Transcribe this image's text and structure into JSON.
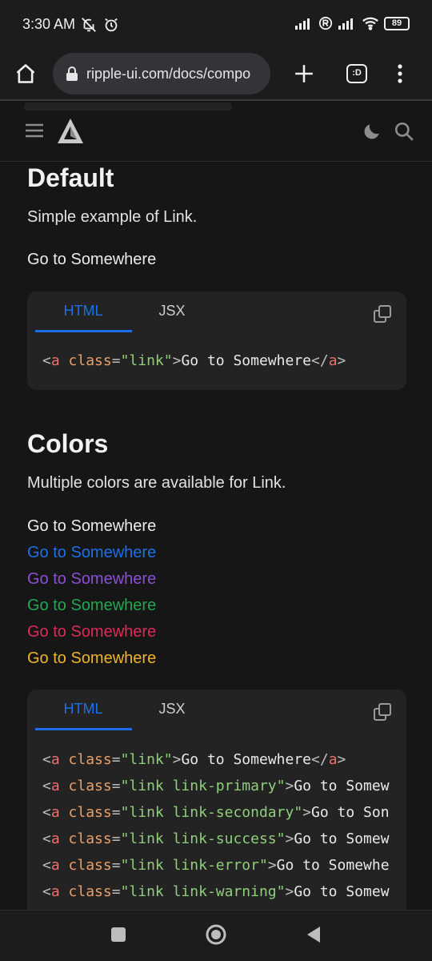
{
  "status": {
    "time": "3:30 AM",
    "battery": "89"
  },
  "browser": {
    "url": "ripple-ui.com/docs/compo",
    "tabs_label": ":D"
  },
  "sections": {
    "default": {
      "heading": "Default",
      "description": "Simple example of Link.",
      "link": "Go to Somewhere",
      "code": {
        "tab_html": "HTML",
        "tab_jsx": "JSX",
        "lines": [
          {
            "cls": "link",
            "text": "Go to Somewhere",
            "close": "</a>"
          }
        ]
      }
    },
    "colors": {
      "heading": "Colors",
      "description": "Multiple colors are available for Link.",
      "links": [
        {
          "label": "Go to Somewhere",
          "color": "#ececec"
        },
        {
          "label": "Go to Somewhere",
          "color": "#1c6fe8"
        },
        {
          "label": "Go to Somewhere",
          "color": "#8c4fd6"
        },
        {
          "label": "Go to Somewhere",
          "color": "#21a852"
        },
        {
          "label": "Go to Somewhere",
          "color": "#e02957"
        },
        {
          "label": "Go to Somewhere",
          "color": "#f0b429"
        }
      ],
      "code": {
        "tab_html": "HTML",
        "tab_jsx": "JSX",
        "lines": [
          {
            "cls": "link",
            "text": "Go to Somewhere",
            "close": "</a>"
          },
          {
            "cls": "link link-primary",
            "text": "Go to Somew",
            "close": ""
          },
          {
            "cls": "link link-secondary",
            "text": "Go to Son",
            "close": ""
          },
          {
            "cls": "link link-success",
            "text": "Go to Somew",
            "close": ""
          },
          {
            "cls": "link link-error",
            "text": "Go to Somewhe",
            "close": ""
          },
          {
            "cls": "link link-warning",
            "text": "Go to Somew",
            "close": ""
          }
        ]
      }
    }
  },
  "colors": {
    "accent": "#1c6fe8",
    "background": "#161616",
    "card": "#232323"
  }
}
